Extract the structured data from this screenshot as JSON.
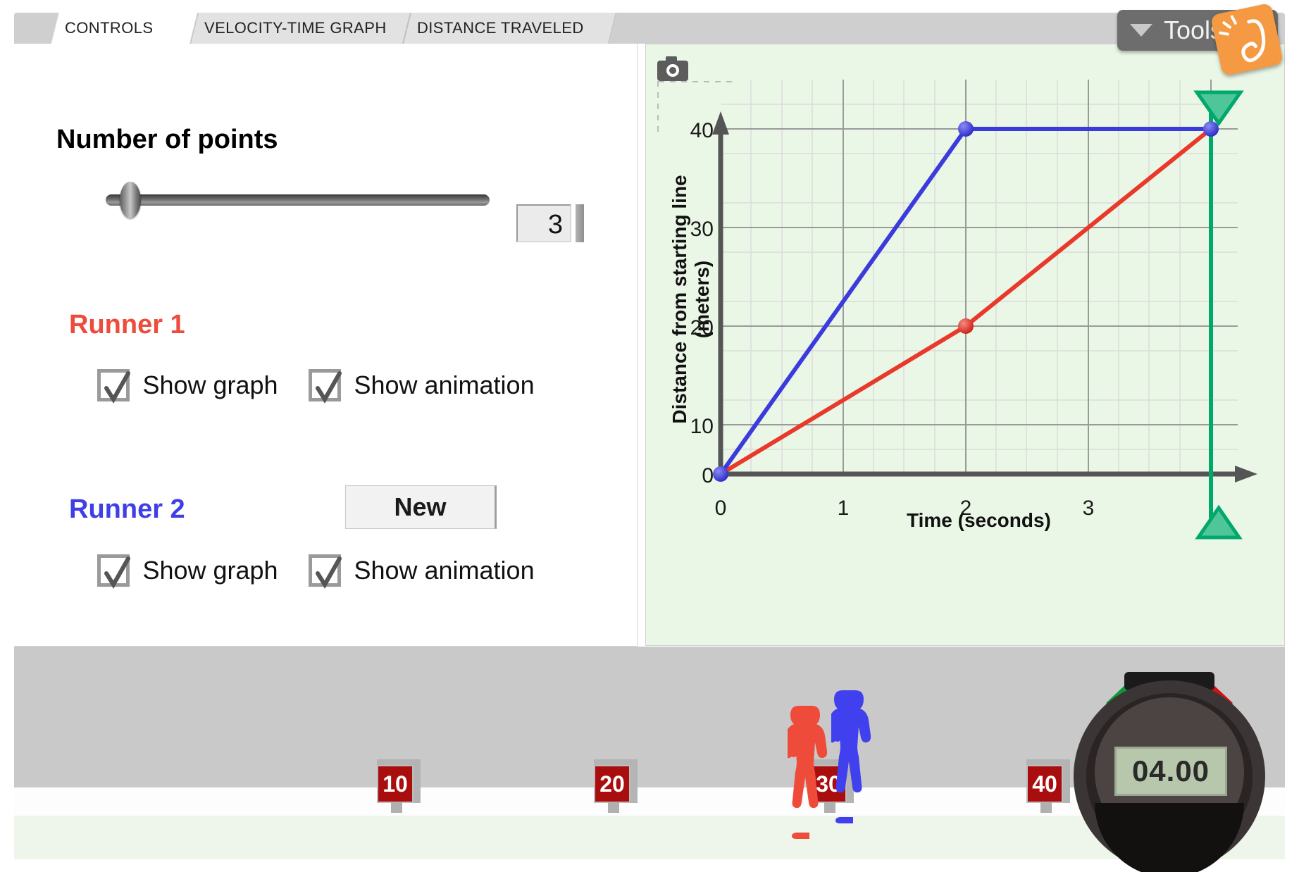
{
  "tabs": [
    {
      "label": "CONTROLS",
      "active": true
    },
    {
      "label": "VELOCITY-TIME GRAPH",
      "active": false
    },
    {
      "label": "DISTANCE TRAVELED",
      "active": false
    }
  ],
  "toolbar": {
    "tools_label": "Tools",
    "caret_icon": "chevron-down-icon",
    "logo_icon": "explorelearning-logo-icon"
  },
  "controls": {
    "points_label": "Number of points",
    "points_value": "3",
    "slider": {
      "min": 1,
      "max": 20,
      "value": 3
    },
    "runner1": {
      "title": "Runner 1",
      "color": "#ee4b3b",
      "show_graph_label": "Show graph",
      "show_graph_checked": true,
      "show_animation_label": "Show animation",
      "show_animation_checked": true
    },
    "runner2": {
      "title": "Runner 2",
      "color": "#3f3fe8",
      "new_button_label": "New",
      "show_graph_label": "Show graph",
      "show_graph_checked": true,
      "show_animation_label": "Show animation",
      "show_animation_checked": true
    }
  },
  "graph": {
    "camera_icon": "camera-icon",
    "background_color": "#eaf7e6",
    "ylabel": "Distance from starting line (meters)",
    "xlabel": "Time (seconds)"
  },
  "chart_data": {
    "type": "line",
    "title": "",
    "xlabel": "Time (seconds)",
    "ylabel": "Distance from starting line (meters)",
    "xlim": [
      0,
      4.35
    ],
    "ylim": [
      0,
      42
    ],
    "xticks": [
      0,
      1,
      2,
      3
    ],
    "yticks": [
      10,
      20,
      30,
      40
    ],
    "grid": true,
    "minor_grid": true,
    "legend": "none",
    "series": [
      {
        "name": "Runner 1",
        "color": "#e8392b",
        "x": [
          0,
          2,
          4
        ],
        "y": [
          0,
          20,
          40
        ],
        "points": [
          {
            "x": 0,
            "y": 0
          },
          {
            "x": 2,
            "y": 20
          },
          {
            "x": 4,
            "y": 40
          }
        ]
      },
      {
        "name": "Runner 2",
        "color": "#3b3bdd",
        "x": [
          0,
          2,
          4
        ],
        "y": [
          0,
          40,
          40
        ],
        "points": [
          {
            "x": 0,
            "y": 0
          },
          {
            "x": 2,
            "y": 40
          },
          {
            "x": 4,
            "y": 40
          }
        ]
      }
    ],
    "annotations": [
      {
        "type": "time-cursor",
        "x": 4,
        "color": "#00a86b",
        "label": ""
      }
    ]
  },
  "animation": {
    "markers": [
      {
        "label": "10"
      },
      {
        "label": "20"
      },
      {
        "label": "30"
      },
      {
        "label": "40"
      }
    ],
    "runner1_icon": "runner-red-icon",
    "runner2_icon": "runner-blue-icon",
    "stopwatch": {
      "time": "04.00",
      "start_button": "start-button",
      "stop_button": "stop-button"
    }
  }
}
